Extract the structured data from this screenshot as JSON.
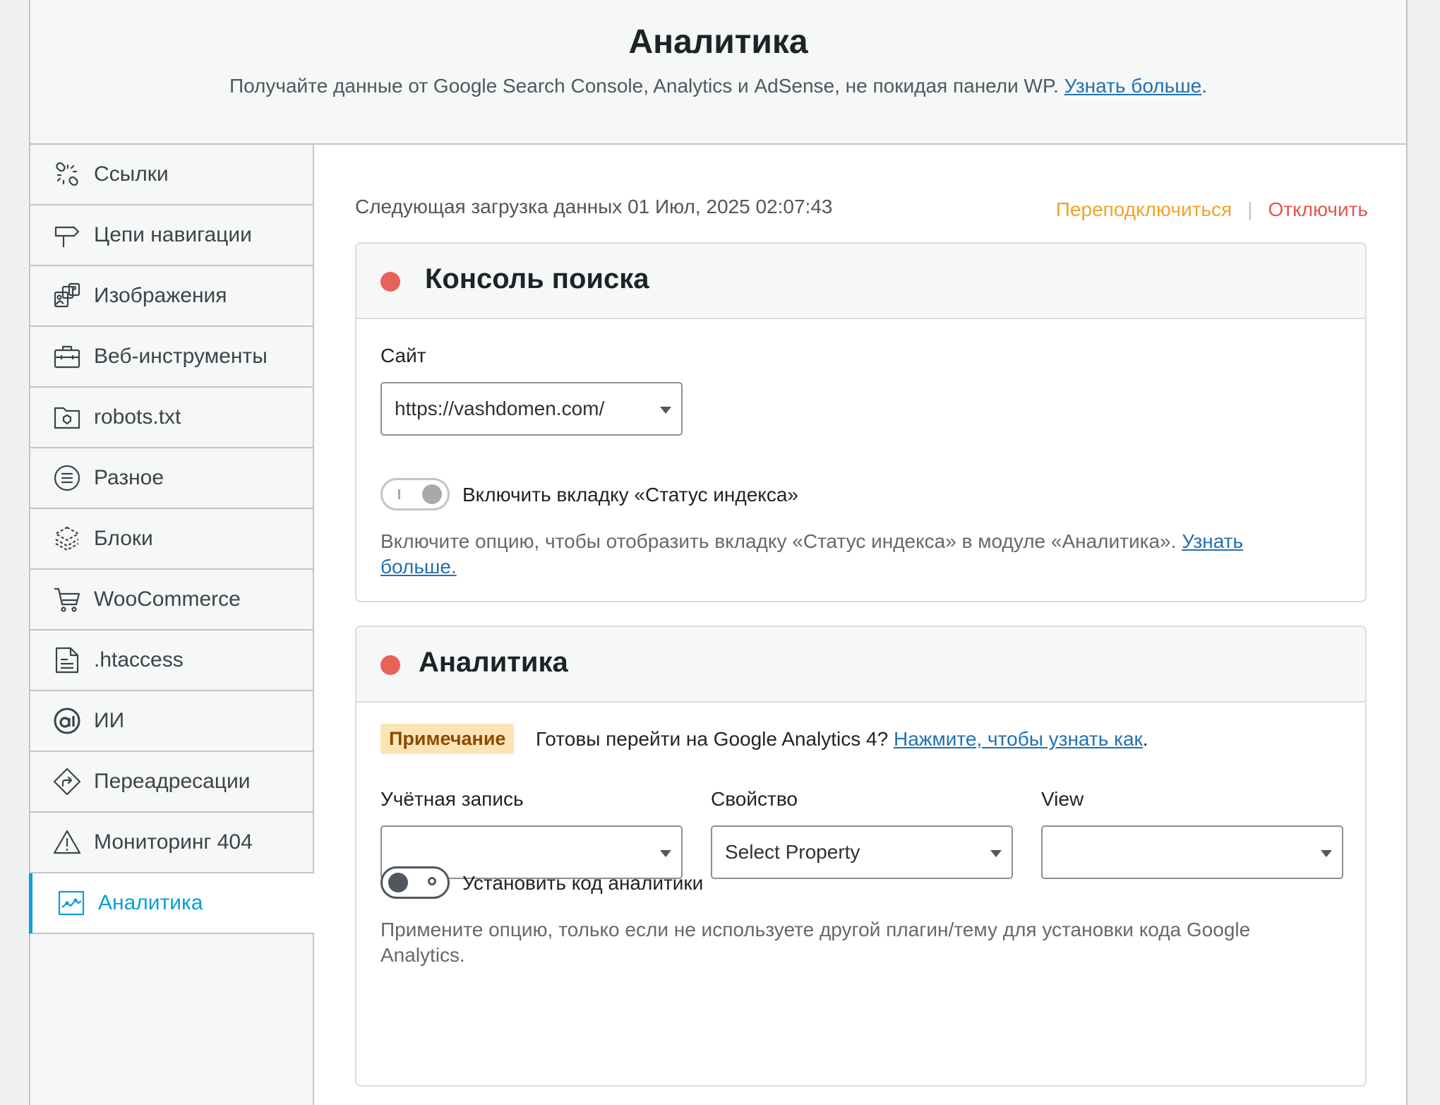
{
  "header": {
    "title": "Аналитика",
    "subtitle": "Получайте данные от Google Search Console, Analytics и AdSense, не покидая панели WP.",
    "learn_more": "Узнать больше",
    "period": "."
  },
  "sidebar": {
    "items": [
      {
        "label": "Ссылки",
        "icon": "link-icon"
      },
      {
        "label": "Цепи навигации",
        "icon": "signpost-icon"
      },
      {
        "label": "Изображения",
        "icon": "images-icon"
      },
      {
        "label": "Веб-инструменты",
        "icon": "toolbox-icon"
      },
      {
        "label": "robots.txt",
        "icon": "folder-icon"
      },
      {
        "label": "Разное",
        "icon": "list-circle-icon"
      },
      {
        "label": "Блоки",
        "icon": "blocks-icon"
      },
      {
        "label": "WooCommerce",
        "icon": "cart-icon"
      },
      {
        "label": ".htaccess",
        "icon": "file-icon"
      },
      {
        "label": "ИИ",
        "icon": "ai-icon"
      },
      {
        "label": "Переадресации",
        "icon": "redirect-icon"
      },
      {
        "label": "Мониторинг 404",
        "icon": "warning-icon"
      },
      {
        "label": "Аналитика",
        "icon": "chart-icon",
        "active": true
      }
    ]
  },
  "main": {
    "next_fetch": "Следующая загрузка данных 01 Июл, 2025 02:07:43",
    "reconnect": "Переподключиться",
    "separator": "|",
    "disconnect": "Отключить",
    "search_console": {
      "title": "Консоль поиска",
      "site_label": "Сайт",
      "site_value": "https://vashdomen.com/",
      "toggle_label": "Включить вкладку «Статус индекса»",
      "desc": "Включите опцию, чтобы отобразить вкладку «Статус индекса» в модуле «Аналитика».",
      "desc_link_1": "Узнать",
      "desc_link_2": "больше."
    },
    "analytics": {
      "title": "Аналитика",
      "note_badge": "Примечание",
      "note_text": "Готовы перейти на Google Analytics 4?",
      "note_link": "Нажмите, чтобы узнать как",
      "note_period": ".",
      "account_label": "Учётная запись",
      "account_value": "",
      "property_label": "Свойство",
      "property_value": "Select Property",
      "view_label": "View",
      "view_value": "",
      "toggle_label": "Установить код аналитики",
      "desc_line1": "Примените опцию, только если не используете другой плагин/тему для установки кода Google",
      "desc_line2": "Analytics."
    }
  },
  "colors": {
    "accent": "#0a9fd8",
    "reconnect": "#f0a32a",
    "disconnect": "#e2574c",
    "status_dot": "#e8625a",
    "badge_bg": "#fce4b5"
  }
}
